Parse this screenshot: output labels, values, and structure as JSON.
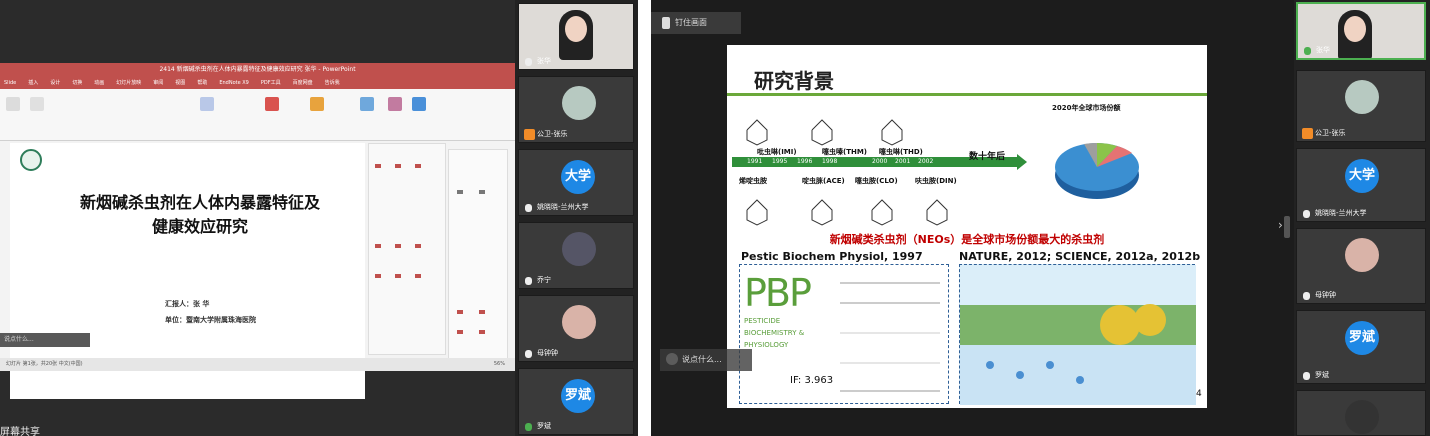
{
  "left_panel": {
    "ppt_title_bar": "2414 新烟碱杀虫剂在人体内暴露特征及健康效应研究 张华 - PowerPoint",
    "ppt_tabs": [
      "Slide",
      "插入",
      "设计",
      "切换",
      "动画",
      "幻灯片放映",
      "审阅",
      "视图",
      "帮助",
      "EndNote X9",
      "PDF工具",
      "百度网盘",
      "告诉我"
    ],
    "slide": {
      "title": "新烟碱杀虫剂在人体内暴露特征及健康效应研究",
      "reporter_label": "汇报人：张 华",
      "unit_label": "单位：暨南大学附属珠海医院"
    },
    "status_bar": "幻灯片 第1张，共20张   中文(中国)",
    "zoom": "56%",
    "chat_placeholder": "说点什么...",
    "share_label": "屏幕共享"
  },
  "left_participants": [
    {
      "name": "张华",
      "type": "video"
    },
    {
      "name": "公卫-张乐",
      "type": "avatar"
    },
    {
      "name": "姚晓晓-兰州大学",
      "type": "initials",
      "initials": "大学"
    },
    {
      "name": "乔宁",
      "type": "avatar"
    },
    {
      "name": "母钟钟",
      "type": "avatar"
    },
    {
      "name": "罗斌",
      "type": "initials",
      "initials": "罗斌"
    }
  ],
  "right_panel": {
    "pin_label": "钉住画面",
    "slide": {
      "section_title": "研究背景",
      "timeline_years": [
        "1991",
        "1995",
        "1996",
        "1998",
        "2000",
        "2001",
        "2002"
      ],
      "chemicals_top": [
        "吡虫啉(IMI)",
        "噻虫嗪(THM)",
        "噻虫啉(THD)"
      ],
      "chemicals_bottom": [
        "烯啶虫胺",
        "啶虫脒(ACE)",
        "噻虫胺(CLO)",
        "呋虫胺(DIN)"
      ],
      "decades_label": "数十年后",
      "pie_title": "2020年全球市场份额",
      "highlight_line": "新烟碱类杀虫剂（NEOs）是全球市场份额最大的杀虫剂",
      "citation_left": "Pestic Biochem Physiol, 1997",
      "citation_right": "NATURE, 2012; SCIENCE, 2012a, 2012b",
      "pbp_big": "PBP",
      "pbp_sub": "PESTICIDE BIOCHEMISTRY & PHYSIOLOGY",
      "impact_factor": "IF: 3.963",
      "page_number": "4"
    },
    "chat_placeholder": "说点什么..."
  },
  "right_participants": [
    {
      "name": "张华",
      "type": "video"
    },
    {
      "name": "公卫-张乐",
      "type": "avatar"
    },
    {
      "name": "姚晓晓-兰州大学",
      "type": "initials",
      "initials": "大学"
    },
    {
      "name": "母钟钟",
      "type": "avatar"
    },
    {
      "name": "罗斌",
      "type": "initials",
      "initials": "罗斌"
    }
  ],
  "colors": {
    "ppt_red": "#c0504d",
    "title_green": "#6ba83a",
    "timeline_green": "#2f8f3a",
    "highlight_red": "#c00000",
    "avatar_blue": "#1e88e5"
  }
}
